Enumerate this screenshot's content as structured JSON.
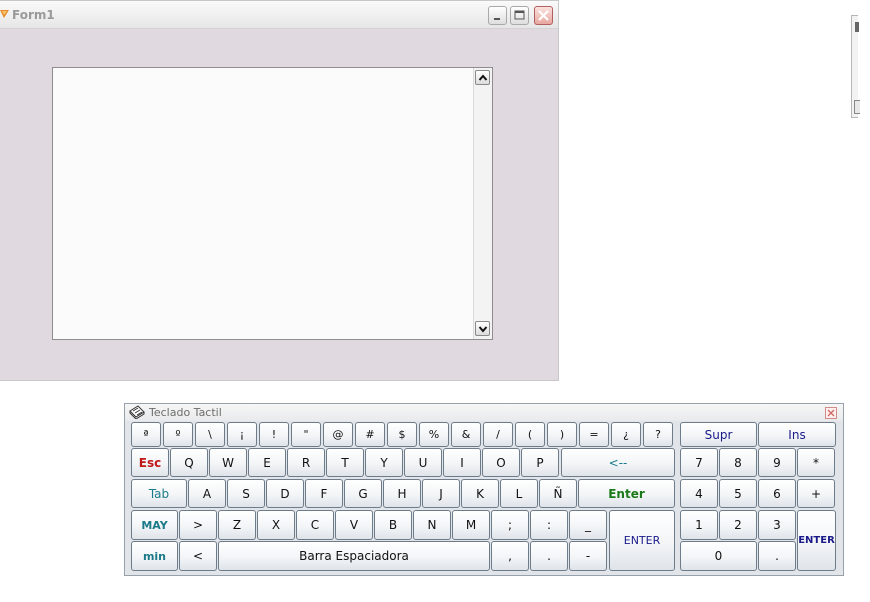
{
  "form1": {
    "title": "Form1"
  },
  "keyboard": {
    "title": "Teclado Tactil",
    "row1": [
      "ª",
      "º",
      "\\",
      "¡",
      "!",
      "\"",
      "@",
      "#",
      "$",
      "%",
      "&",
      "/",
      "(",
      ")",
      "=",
      "¿",
      "?"
    ],
    "row2": [
      "Q",
      "W",
      "E",
      "R",
      "T",
      "Y",
      "U",
      "I",
      "O",
      "P"
    ],
    "row3": [
      "A",
      "S",
      "D",
      "F",
      "G",
      "H",
      "J",
      "K",
      "L",
      "Ñ"
    ],
    "row4": [
      ">",
      "Z",
      "X",
      "C",
      "V",
      "B",
      "N",
      "M",
      ";",
      ":",
      "_"
    ],
    "row5_left": [
      "<"
    ],
    "row5_right": [
      ",",
      ".",
      "-"
    ],
    "esc": "Esc",
    "backspace": "<--",
    "tab": "Tab",
    "enter_small": "Enter",
    "may": "MAY",
    "min": "min",
    "enter_big": "ENTER",
    "space": "Barra Espaciadora",
    "numpad": {
      "supr": "Supr",
      "ins": "Ins",
      "rows": [
        [
          "7",
          "8",
          "9",
          "*"
        ],
        [
          "4",
          "5",
          "6",
          "+"
        ],
        [
          "1",
          "2",
          "3"
        ]
      ],
      "zero": "0",
      "dot": ".",
      "enter": "ENTER"
    }
  },
  "colors": {
    "esc": "#c01818",
    "teal": "#1a7a8a",
    "enter_small": "#1a7a1a",
    "navy": "#1a1a8a"
  }
}
